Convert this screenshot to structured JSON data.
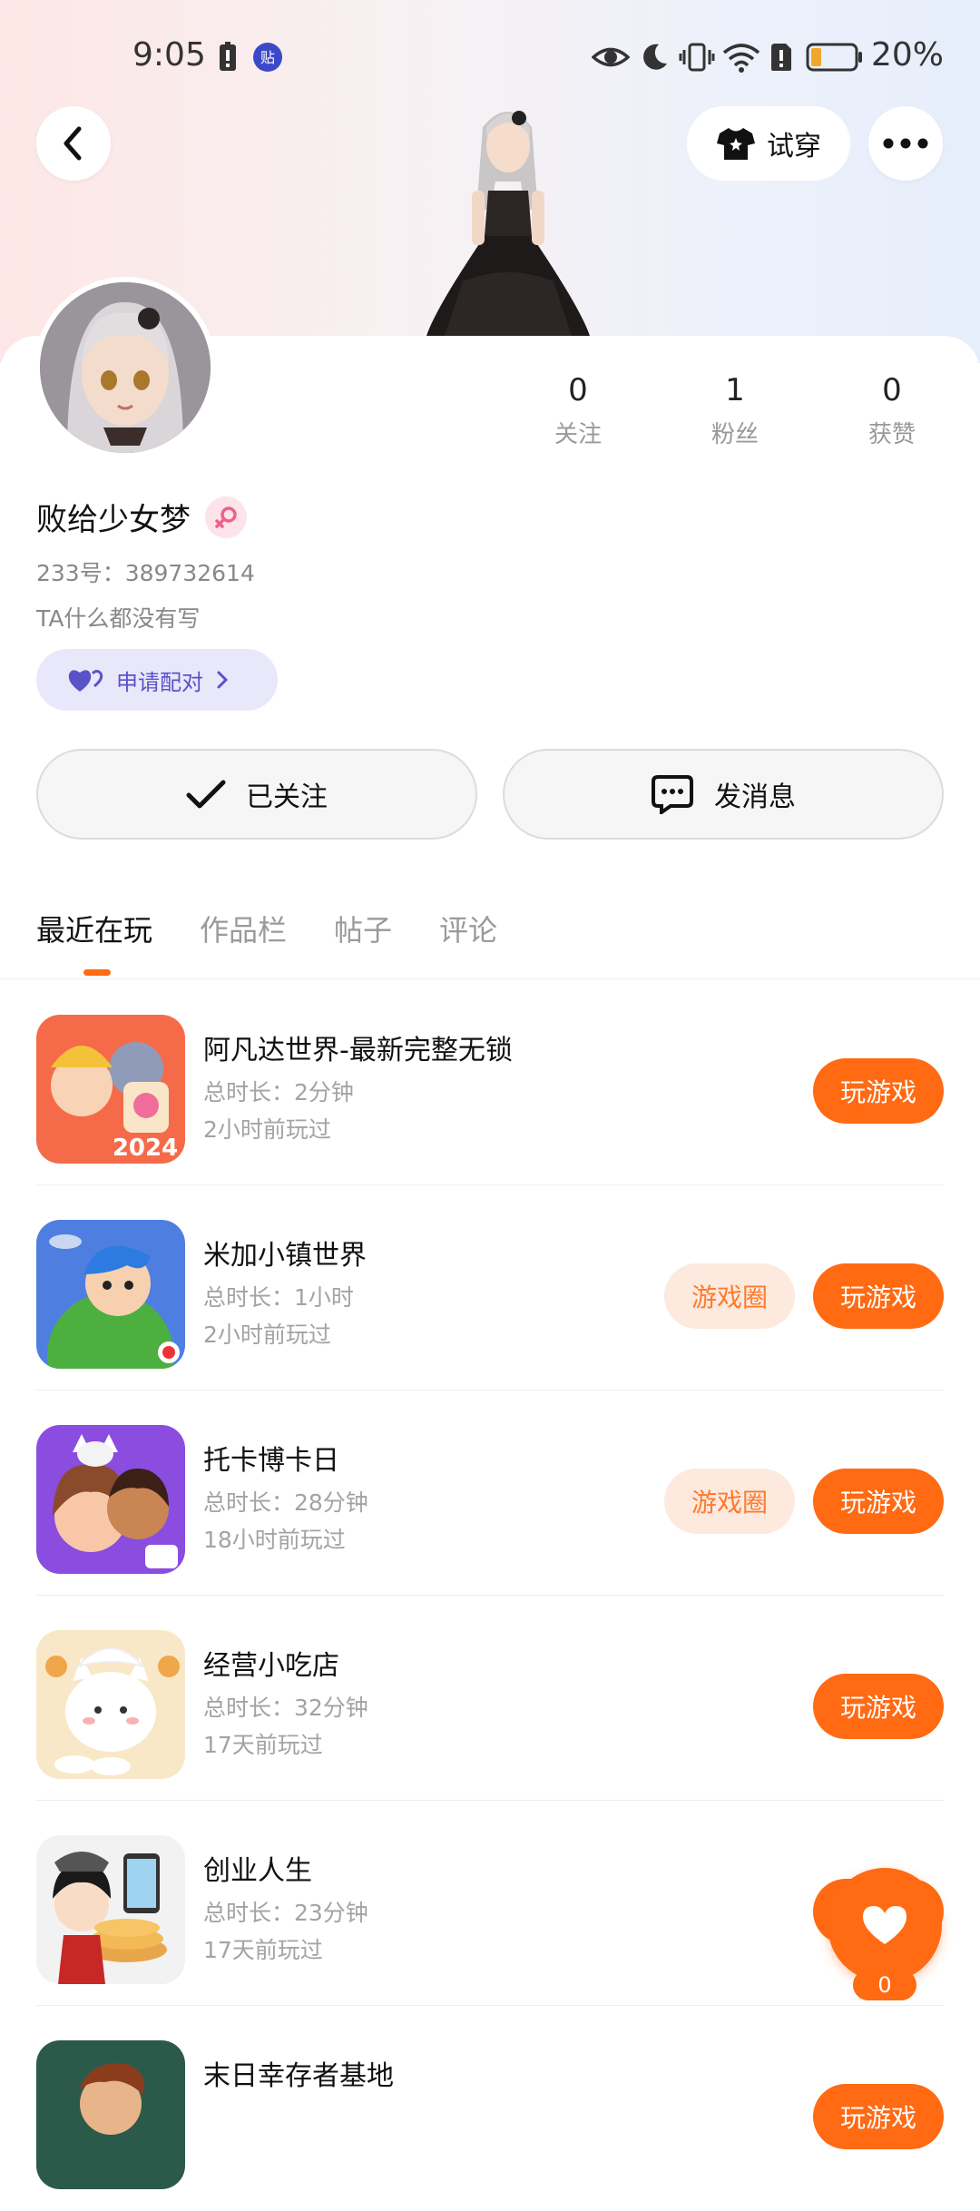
{
  "status_bar": {
    "time": "9:05",
    "battery": "20%"
  },
  "header": {
    "try_on_label": "试穿"
  },
  "profile": {
    "stats": [
      {
        "value": "0",
        "label": "关注"
      },
      {
        "value": "1",
        "label": "粉丝"
      },
      {
        "value": "0",
        "label": "获赞"
      }
    ],
    "name": "败给少女梦",
    "uid": "233号：389732614",
    "bio": "TA什么都没有写",
    "pair_label": "申请配对"
  },
  "actions": {
    "followed": "已关注",
    "message": "发消息"
  },
  "tabs": [
    "最近在玩",
    "作品栏",
    "帖子",
    "评论"
  ],
  "games": [
    {
      "name": "阿凡达世界-最新完整无锁",
      "duration": "总时长：2分钟",
      "last_played": "2小时前玩过",
      "icon_badge": "2024"
    },
    {
      "name": "米加小镇世界",
      "duration": "总时长：1小时",
      "last_played": "2小时前玩过",
      "circle_label": "游戏圈"
    },
    {
      "name": "托卡博卡日",
      "duration": "总时长：28分钟",
      "last_played": "18小时前玩过",
      "circle_label": "游戏圈"
    },
    {
      "name": "经营小吃店",
      "duration": "总时长：32分钟",
      "last_played": "17天前玩过"
    },
    {
      "name": "创业人生",
      "duration": "总时长：23分钟",
      "last_played": "17天前玩过"
    },
    {
      "name": "末日幸存者基地"
    }
  ],
  "play_label": "玩游戏",
  "floating_like": {
    "count": "0"
  },
  "colors": {
    "accent": "#ff6a13",
    "accent_soft": "#fde9de",
    "pair_bg": "#e9e8fb"
  }
}
